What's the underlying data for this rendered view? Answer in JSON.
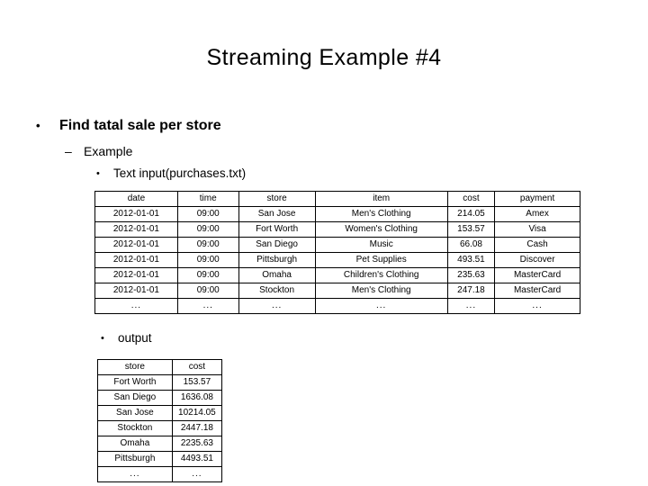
{
  "slide": {
    "title": "Streaming Example #4"
  },
  "bullets": {
    "level1": {
      "marker": "•",
      "text": "Find tatal sale per store"
    },
    "level2": {
      "marker": "–",
      "text": "Example"
    },
    "level3_input": {
      "marker": "•",
      "text": "Text input(purchases.txt)"
    },
    "level3_output": {
      "marker": "•",
      "text": "output"
    }
  },
  "input_table": {
    "headers": [
      "date",
      "time",
      "store",
      "item",
      "cost",
      "payment"
    ],
    "rows": [
      [
        "2012-01-01",
        "09:00",
        "San Jose",
        "Men's Clothing",
        "214.05",
        "Amex"
      ],
      [
        "2012-01-01",
        "09:00",
        "Fort Worth",
        "Women's Clothing",
        "153.57",
        "Visa"
      ],
      [
        "2012-01-01",
        "09:00",
        "San Diego",
        "Music",
        "66.08",
        "Cash"
      ],
      [
        "2012-01-01",
        "09:00",
        "Pittsburgh",
        "Pet Supplies",
        "493.51",
        "Discover"
      ],
      [
        "2012-01-01",
        "09:00",
        "Omaha",
        "Children's Clothing",
        "235.63",
        "MasterCard"
      ],
      [
        "2012-01-01",
        "09:00",
        "Stockton",
        "Men's Clothing",
        "247.18",
        "MasterCard"
      ],
      [
        "...",
        "...",
        "...",
        "...",
        "...",
        "..."
      ]
    ]
  },
  "output_table": {
    "headers": [
      "store",
      "cost"
    ],
    "rows": [
      [
        "Fort Worth",
        "153.57"
      ],
      [
        "San Diego",
        "1636.08"
      ],
      [
        "San Jose",
        "10214.05"
      ],
      [
        "Stockton",
        "2447.18"
      ],
      [
        "Omaha",
        "2235.63"
      ],
      [
        "Pittsburgh",
        "4493.51"
      ],
      [
        "...",
        "..."
      ]
    ]
  },
  "colors": {
    "background": "#ffffff",
    "text": "#000000",
    "table_border": "#000000"
  }
}
